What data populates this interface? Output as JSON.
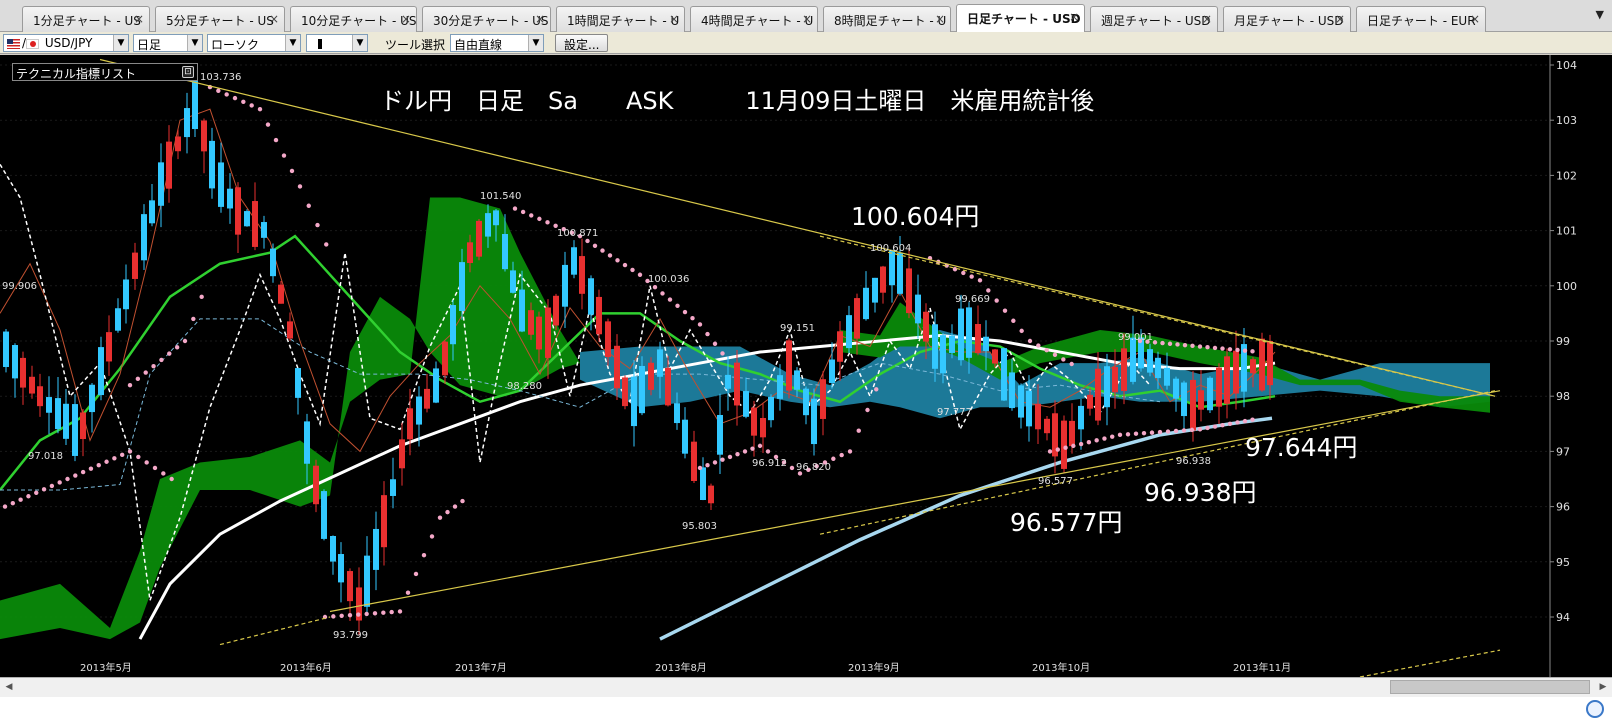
{
  "tabs": [
    {
      "label": "1分足チャート - US",
      "active": false
    },
    {
      "label": "5分足チャート - US",
      "active": false
    },
    {
      "label": "10分足チャート - US",
      "active": false
    },
    {
      "label": "30分足チャート - US",
      "active": false
    },
    {
      "label": "1時間足チャート - U",
      "active": false
    },
    {
      "label": "4時間足チャート - U",
      "active": false
    },
    {
      "label": "8時間足チャート - U",
      "active": false
    },
    {
      "label": "日足チャート - USD",
      "active": true
    },
    {
      "label": "週足チャート - USD",
      "active": false
    },
    {
      "label": "月足チャート - USD",
      "active": false
    },
    {
      "label": "日足チャート - EUR",
      "active": false
    }
  ],
  "tab_close_glyph": "×",
  "tab_scroll_glyph": "▼",
  "toolbar": {
    "symbol": "USD/JPY",
    "timeframe": "日足",
    "chart_type": "ローソク",
    "tool_label": "ツール選択",
    "tool_value": "自由直線",
    "settings_button": "設定..."
  },
  "indicator_list_label": "テクニカル指標リスト",
  "chart_data": {
    "type": "candlestick",
    "title": "ドル円　日足　Sa　　ASK　　　11月09日土曜日　米雇用統計後",
    "y_ticks": [
      "104",
      "103",
      "102",
      "101",
      "100",
      "99",
      "98",
      "97",
      "96",
      "95",
      "94"
    ],
    "ylim": [
      93.6,
      104.1
    ],
    "x_labels": [
      "2013年5月",
      "2013年6月",
      "2013年7月",
      "2013年8月",
      "2013年9月",
      "2013年10月",
      "2013年11月"
    ],
    "price_labels": [
      "103.736",
      "101.540",
      "100.871",
      "100.036",
      "100.604",
      "99.669",
      "99.151",
      "99.001",
      "98.280",
      "97.777",
      "99.906",
      "97.018",
      "95.803",
      "96.912",
      "96.820",
      "96.577",
      "96.938",
      "93.799"
    ],
    "annotations": [
      "100.604円",
      "97.644円",
      "96.938円",
      "96.577円"
    ],
    "last_close": 98.6
  },
  "colors": {
    "bull_candle": "#e83030",
    "bear_candle": "#33c8ff",
    "kumo_green": "#0a8a0a",
    "kumo_blue": "#1e7fa0",
    "sma_white": "#ffffff",
    "sma_lightblue": "#a8d8f0",
    "ma_green": "#30d030",
    "trend_yellow": "#d8c84a",
    "parabolic": "#f4a8c8"
  },
  "scrollbar": {
    "left": "◀",
    "right": "▶"
  }
}
